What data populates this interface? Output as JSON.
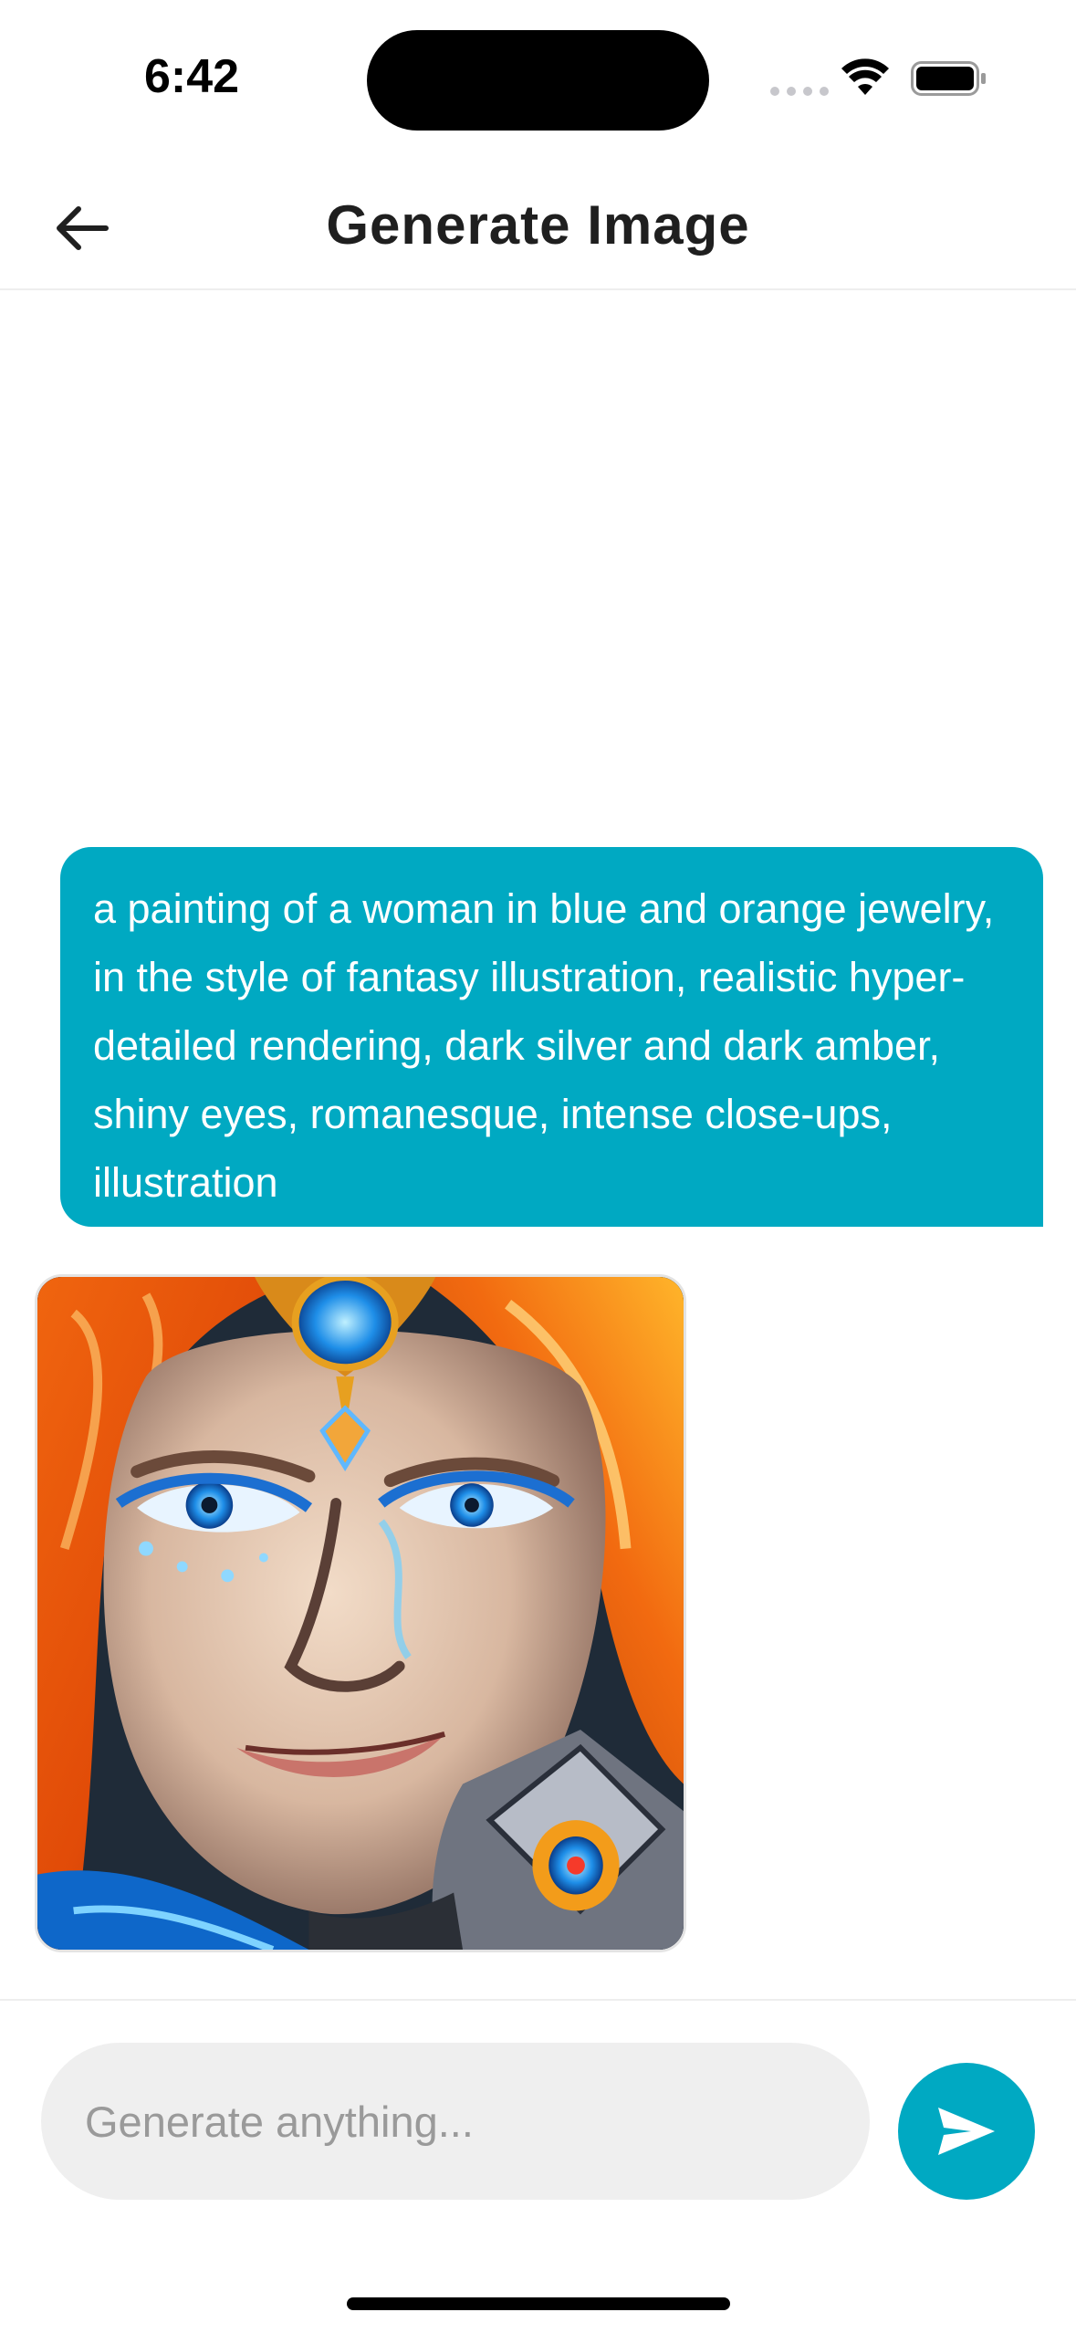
{
  "status_bar": {
    "time": "6:42"
  },
  "header": {
    "title": "Generate Image",
    "back_icon": "arrow-left-icon"
  },
  "chat": {
    "messages": [
      {
        "role": "user",
        "text": "a painting of a woman in blue and orange jewelry, in the style of fantasy illustration, realistic hyper-detailed rendering, dark silver and dark amber, shiny eyes, romanesque, intense close-ups, illustration"
      },
      {
        "role": "assistant",
        "type": "image"
      }
    ]
  },
  "composer": {
    "placeholder": "Generate anything...",
    "value": "",
    "send_icon": "send-icon"
  },
  "colors": {
    "accent": "#00a9c2",
    "input_bg": "#efefef",
    "title_text": "#1f1f1f"
  }
}
